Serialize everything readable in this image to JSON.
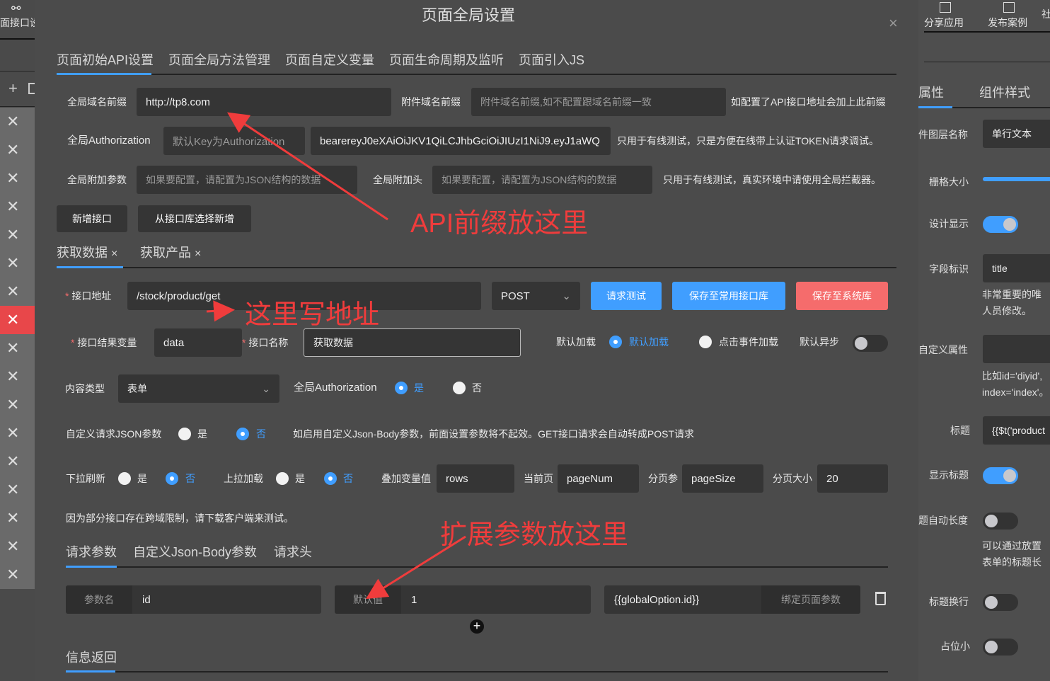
{
  "left": {
    "top_label": "面接口设",
    "items_count": 17,
    "active_index": 7
  },
  "dialog": {
    "title": "页面全局设置",
    "tabs": [
      "页面初始API设置",
      "页面全局方法管理",
      "页面自定义变量",
      "页面生命周期及监听",
      "页面引入JS"
    ],
    "domain_label": "全局域名前缀",
    "domain_value": "http://tp8.com",
    "attach_label": "附件域名前缀",
    "attach_placeholder": "附件域名前缀,如不配置跟域名前缀一致",
    "attach_hint": "如配置了API接口地址会加上此前缀",
    "auth_label": "全局Authorization",
    "auth_key_placeholder": "默认Key为Authorization",
    "auth_value": "bearereyJ0eXAiOiJKV1QiLCJhbGciOiJIUzI1NiJ9.eyJ1aWQ",
    "auth_hint": "只用于有线测试，只是方便在线带上认证TOKEN请求调试。",
    "param_label": "全局附加参数",
    "param_placeholder": "如果要配置，请配置为JSON结构的数据",
    "header_label": "全局附加头",
    "header_placeholder": "如果要配置，请配置为JSON结构的数据",
    "header_hint": "只用于有线测试，真实环境中请使用全局拦截器。",
    "add_api": "新增接口",
    "add_from_lib": "从接口库选择新增",
    "api_tabs": [
      "获取数据",
      "获取产品"
    ],
    "url_label": "接口地址",
    "url_value": "/stock/product/get",
    "method": "POST",
    "btn_test": "请求测试",
    "btn_save_common": "保存至常用接口库",
    "btn_save_sys": "保存至系统库",
    "result_label": "接口结果变量",
    "result_value": "data",
    "name_label": "接口名称",
    "name_value": "获取数据",
    "load_label": "默认加载",
    "load_opt1": "默认加载",
    "load_opt2": "点击事件加载",
    "async_label": "默认异步",
    "ctype_label": "内容类型",
    "ctype_value": "表单",
    "gauth_label": "全局Authorization",
    "yes": "是",
    "no": "否",
    "json_label": "自定义请求JSON参数",
    "json_hint": "如启用自定义Json-Body参数，前面设置参数将不起效。GET接口请求会自动转成POST请求",
    "pull_label": "下拉刷新",
    "push_label": "上拉加载",
    "append_label": "叠加变量值",
    "append_value": "rows",
    "cur_label": "当前页",
    "cur_value": "pageNum",
    "ps_label": "分页参",
    "ps_value": "pageSize",
    "size_label": "分页大小",
    "size_value": "20",
    "cors_hint": "因为部分接口存在跨域限制，请下载客户端来测试。",
    "req_tabs": [
      "请求参数",
      "自定义Json-Body参数",
      "请求头"
    ],
    "param_name_label": "参数名",
    "param_name_value": "id",
    "default_label": "默认值",
    "default_value": "1",
    "bind_value": "{{globalOption.id}}",
    "bind_label": "绑定页面参数",
    "info_return": "信息返回"
  },
  "annotations": [
    "API前缀放这里",
    "这里写地址",
    "扩展参数放这里"
  ],
  "right": {
    "top": [
      "分享应用",
      "发布案例",
      "社"
    ],
    "tabs": [
      "属性",
      "组件样式"
    ],
    "layer_label": "件图层名称",
    "layer_value": "单行文本",
    "grid_label": "栅格大小",
    "design_label": "设计显示",
    "field_label": "字段标识",
    "field_value": "title",
    "field_note": [
      "非常重要的唯",
      "人员修改。"
    ],
    "custom_label": "自定义属性",
    "custom_note": [
      "比如id='diyid',",
      "index='index'。"
    ],
    "title_label": "标题",
    "title_value": "{{$t('product",
    "show_title": "显示标题",
    "auto_len": "题自动长度",
    "auto_note": [
      "可以通过放置",
      "表单的标题长"
    ],
    "wrap_label": "标题换行",
    "small_label": "占位小"
  },
  "colors": {
    "accent": "#409eff",
    "danger": "#f56c6c",
    "annotation": "#f03c3c"
  }
}
